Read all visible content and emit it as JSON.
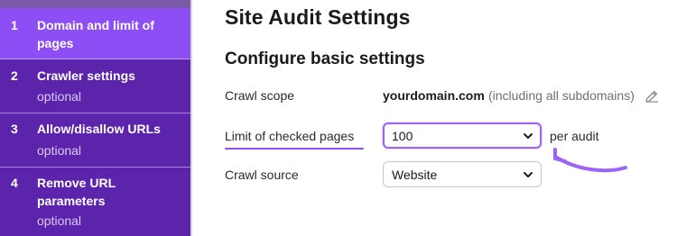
{
  "sidebar": {
    "steps": [
      {
        "number": "1",
        "title": "Domain and limit of pages",
        "subtitle": ""
      },
      {
        "number": "2",
        "title": "Crawler settings",
        "subtitle": "optional"
      },
      {
        "number": "3",
        "title": "Allow/disallow URLs",
        "subtitle": "optional"
      },
      {
        "number": "4",
        "title": "Remove URL parameters",
        "subtitle": "optional"
      }
    ]
  },
  "main": {
    "title": "Site Audit Settings",
    "section_title": "Configure basic settings",
    "crawl_scope": {
      "label": "Crawl scope",
      "domain": "yourdomain.com",
      "note": "(including all subdomains)"
    },
    "limit": {
      "label": "Limit of checked pages",
      "value": "100",
      "suffix": "per audit"
    },
    "crawl_source": {
      "label": "Crawl source",
      "value": "Website"
    }
  },
  "colors": {
    "sidebar_bg": "#5b24ab",
    "sidebar_active": "#8d4ef5",
    "accent": "#9b63f8"
  },
  "icons": [
    "pencil-icon",
    "chevron-down-icon",
    "curved-arrow-icon"
  ]
}
